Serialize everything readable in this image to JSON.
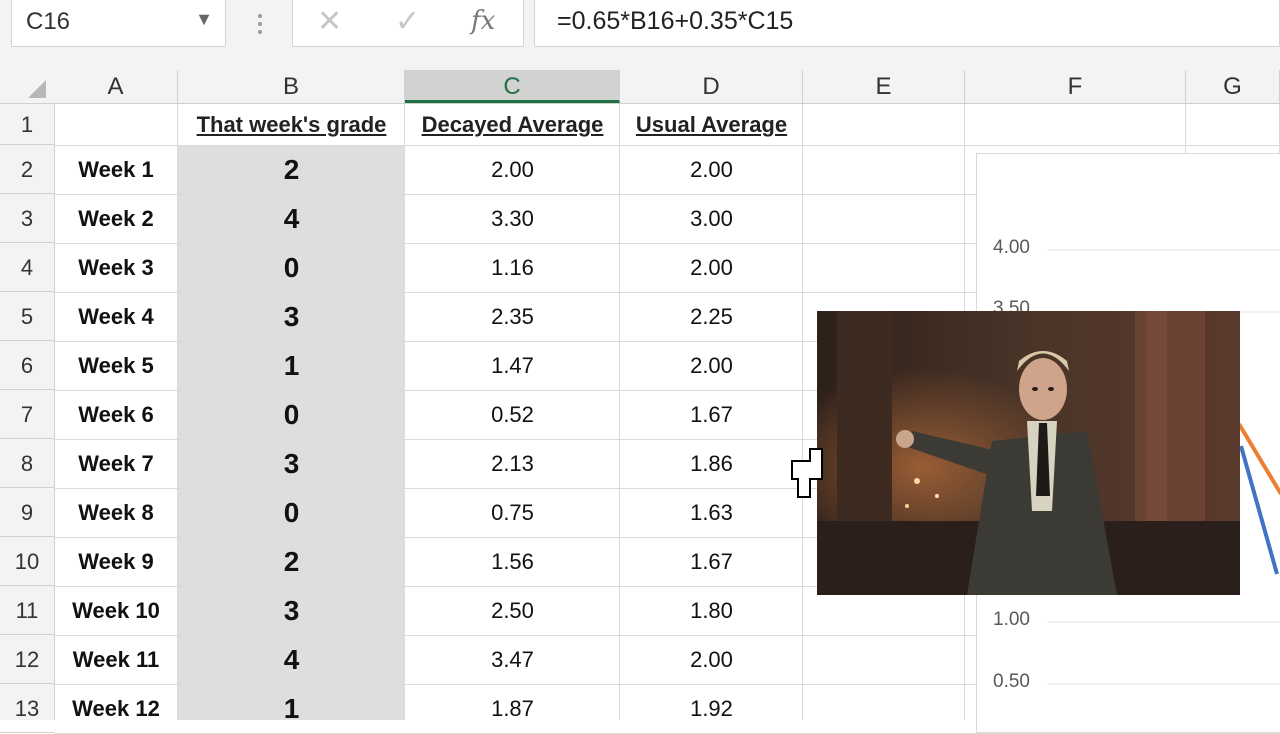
{
  "formula_bar": {
    "name_box": "C16",
    "cancel_glyph": "✕",
    "enter_glyph": "✓",
    "fx_label": "fx",
    "formula": "=0.65*B16+0.35*C15"
  },
  "columns": [
    "A",
    "B",
    "C",
    "D",
    "E",
    "F",
    "G"
  ],
  "selected_column": "C",
  "headers": {
    "b": "That week's grade",
    "c": "Decayed Average",
    "d": "Usual Average"
  },
  "rows": [
    {
      "num": "1"
    },
    {
      "num": "2",
      "label": "Week 1",
      "grade": "2",
      "decayed": "2.00",
      "usual": "2.00"
    },
    {
      "num": "3",
      "label": "Week 2",
      "grade": "4",
      "decayed": "3.30",
      "usual": "3.00"
    },
    {
      "num": "4",
      "label": "Week 3",
      "grade": "0",
      "decayed": "1.16",
      "usual": "2.00"
    },
    {
      "num": "5",
      "label": "Week 4",
      "grade": "3",
      "decayed": "2.35",
      "usual": "2.25"
    },
    {
      "num": "6",
      "label": "Week 5",
      "grade": "1",
      "decayed": "1.47",
      "usual": "2.00"
    },
    {
      "num": "7",
      "label": "Week 6",
      "grade": "0",
      "decayed": "0.52",
      "usual": "1.67"
    },
    {
      "num": "8",
      "label": "Week 7",
      "grade": "3",
      "decayed": "2.13",
      "usual": "1.86"
    },
    {
      "num": "9",
      "label": "Week 8",
      "grade": "0",
      "decayed": "0.75",
      "usual": "1.63"
    },
    {
      "num": "10",
      "label": "Week 9",
      "grade": "2",
      "decayed": "1.56",
      "usual": "1.67"
    },
    {
      "num": "11",
      "label": "Week 10",
      "grade": "3",
      "decayed": "2.50",
      "usual": "1.80"
    },
    {
      "num": "12",
      "label": "Week 11",
      "grade": "4",
      "decayed": "3.47",
      "usual": "2.00"
    },
    {
      "num": "13",
      "label": "Week 12",
      "grade": "1",
      "decayed": "1.87",
      "usual": "1.92"
    }
  ],
  "chart": {
    "y_ticks": [
      "4.00",
      "3.50",
      "1.00",
      "0.50"
    ],
    "series_colors": {
      "decayed": "#4472c4",
      "usual": "#ed7d31"
    }
  },
  "colors": {
    "accent": "#217346",
    "selected_column_bg": "#d2d2d2",
    "shaded_column_bg": "#dedede"
  },
  "overlay": {
    "content": "movie-still-man-in-suit"
  },
  "cursor": {
    "icon": "move-cursor-icon"
  }
}
